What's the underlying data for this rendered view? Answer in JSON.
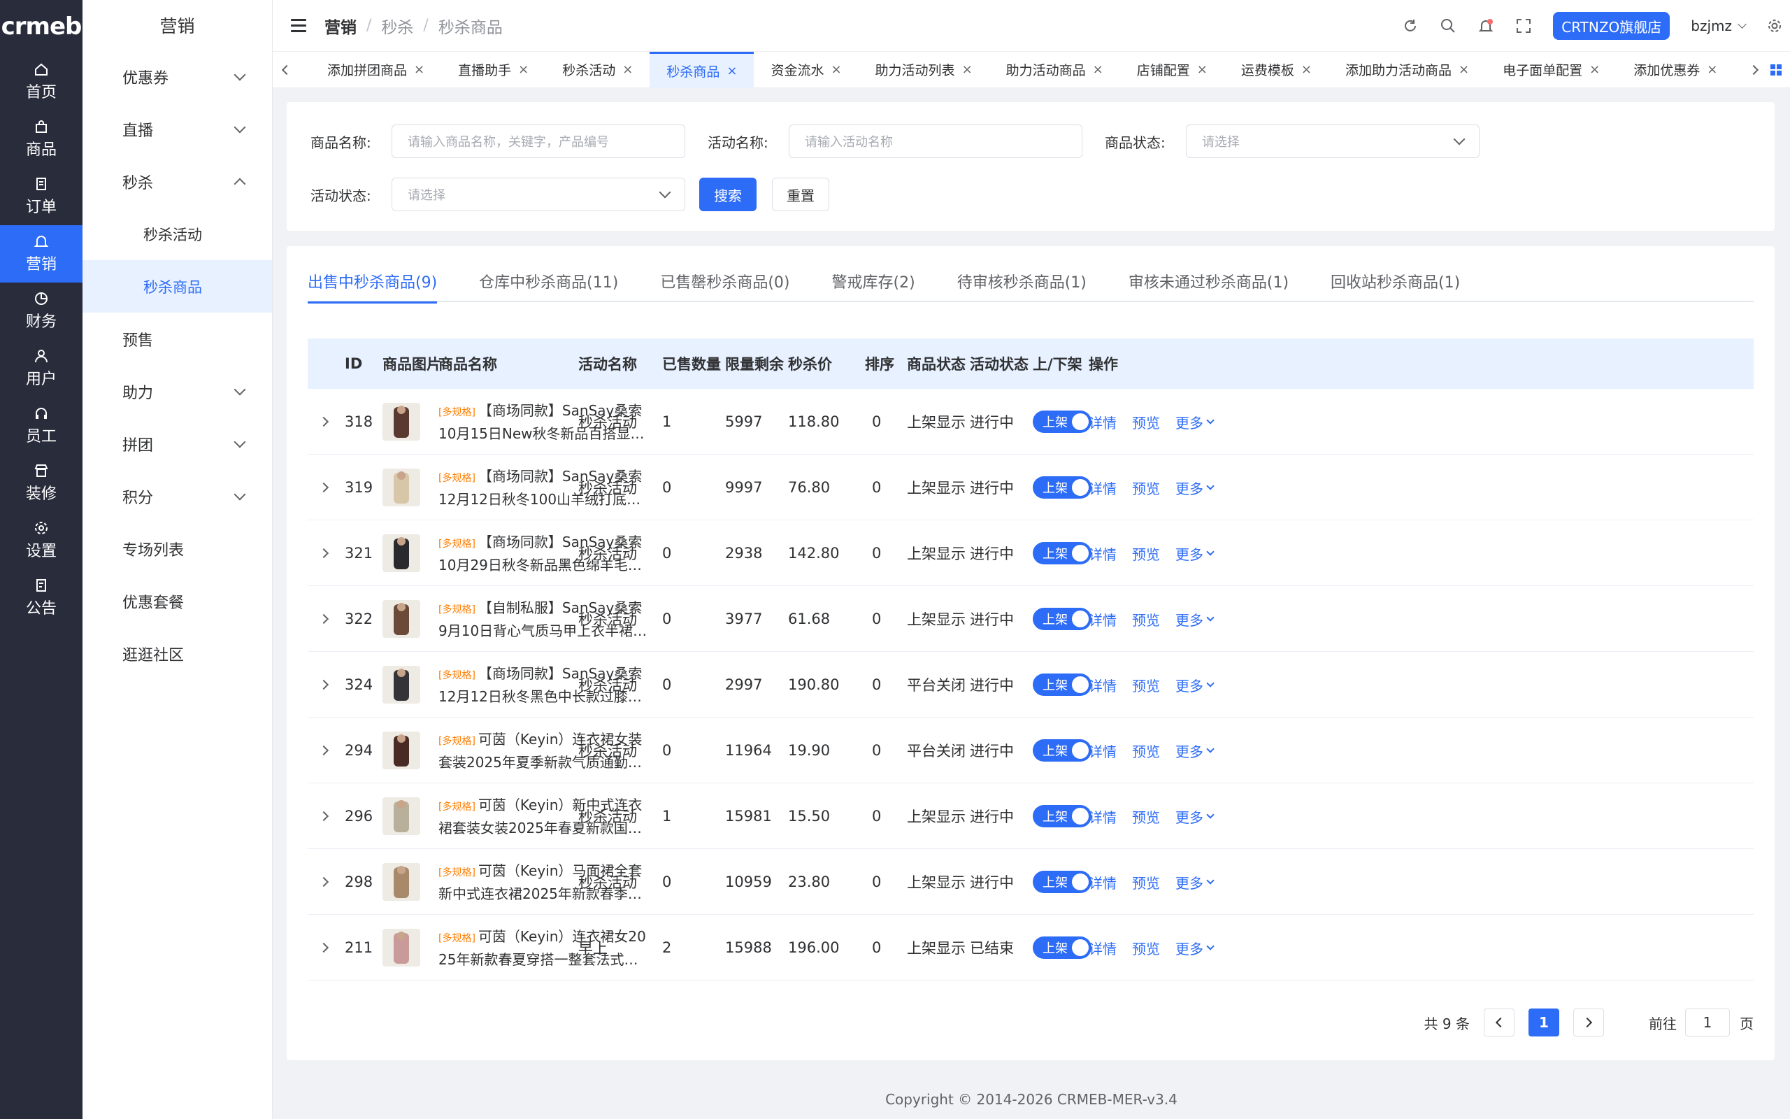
{
  "logo": "crmeb",
  "rail": [
    {
      "label": "首页",
      "icon": "home-icon"
    },
    {
      "label": "商品",
      "icon": "bag-icon"
    },
    {
      "label": "订单",
      "icon": "order-icon"
    },
    {
      "label": "营销",
      "icon": "bell-icon"
    },
    {
      "label": "财务",
      "icon": "pie-icon"
    },
    {
      "label": "用户",
      "icon": "user-icon"
    },
    {
      "label": "员工",
      "icon": "headset-icon"
    },
    {
      "label": "装修",
      "icon": "shop-icon"
    },
    {
      "label": "设置",
      "icon": "gear-icon"
    },
    {
      "label": "公告",
      "icon": "notice-icon"
    }
  ],
  "sub_menu": {
    "title": "营销",
    "items": [
      {
        "label": "优惠券"
      },
      {
        "label": "直播"
      },
      {
        "label": "秒杀"
      },
      {
        "label": "秒杀活动"
      },
      {
        "label": "秒杀商品"
      },
      {
        "label": "预售"
      },
      {
        "label": "助力"
      },
      {
        "label": "拼团"
      },
      {
        "label": "积分"
      },
      {
        "label": "专场列表"
      },
      {
        "label": "优惠套餐"
      },
      {
        "label": "逛逛社区"
      }
    ]
  },
  "breadcrumb": [
    "营销",
    "秒杀",
    "秒杀商品"
  ],
  "breadcrumb_sep": "/",
  "header": {
    "store": "CRTNZO旗舰店",
    "user": "bzjmz"
  },
  "tabs": [
    "添加拼团商品",
    "直播助手",
    "秒杀活动",
    "秒杀商品",
    "资金流水",
    "助力活动列表",
    "助力活动商品",
    "店铺配置",
    "运费模板",
    "添加助力活动商品",
    "电子面单配置",
    "添加优惠券"
  ],
  "tab_close": "×",
  "filter": {
    "product_name_label": "商品名称:",
    "product_name_placeholder": "请输入商品名称，关键字，产品编号",
    "activity_name_label": "活动名称:",
    "activity_name_placeholder": "请输入活动名称",
    "product_status_label": "商品状态:",
    "product_status_placeholder": "请选择",
    "activity_status_label": "活动状态:",
    "activity_status_placeholder": "请选择",
    "search": "搜索",
    "reset": "重置"
  },
  "panel_tabs": [
    "出售中秒杀商品(9)",
    "仓库中秒杀商品(11)",
    "已售罄秒杀商品(0)",
    "警戒库存(2)",
    "待审核秒杀商品(1)",
    "审核未通过秒杀商品(1)",
    "回收站秒杀商品(1)"
  ],
  "columns": [
    "ID",
    "商品图片",
    "商品名称",
    "活动名称",
    "已售数量",
    "限量剩余",
    "秒杀价",
    "排序",
    "商品状态",
    "活动状态",
    "上/下架",
    "操作"
  ],
  "spec_tag": "[多规格]",
  "switch_label": "上架",
  "actions": {
    "detail": "详情",
    "preview": "预览",
    "more": "更多"
  },
  "rows": [
    {
      "id": "318",
      "name1": "【商场同款】SanSay桑索",
      "name2": "10月15日New秋冬新品百搭显瘦…",
      "activity": "秒杀活动",
      "sold": "1",
      "remain": "5997",
      "price": "118.80",
      "sort": "0",
      "pstatus": "上架显示",
      "astatus": "进行中",
      "color": "#5a3a30"
    },
    {
      "id": "319",
      "name1": "【商场同款】SanSay桑索",
      "name2": "12月12日秋冬100山羊绒打底衫…",
      "activity": "秒杀活动",
      "sold": "0",
      "remain": "9997",
      "price": "76.80",
      "sort": "0",
      "pstatus": "上架显示",
      "astatus": "进行中",
      "color": "#d8c6a8"
    },
    {
      "id": "321",
      "name1": "【商场同款】SanSay桑索",
      "name2": "10月29日秋冬新品黑色绵羊毛呢…",
      "activity": "秒杀活动",
      "sold": "0",
      "remain": "2938",
      "price": "142.80",
      "sort": "0",
      "pstatus": "上架显示",
      "astatus": "进行中",
      "color": "#2a2a2e"
    },
    {
      "id": "322",
      "name1": "【自制私服】SanSay桑索",
      "name2": "9月10日背心气质马甲上衣半裙…",
      "activity": "秒杀活动",
      "sold": "0",
      "remain": "3977",
      "price": "61.68",
      "sort": "0",
      "pstatus": "上架显示",
      "astatus": "进行中",
      "color": "#6b4a3a"
    },
    {
      "id": "324",
      "name1": "【商场同款】SanSay桑索",
      "name2": "12月12日秋冬黑色中长款过膝羽…",
      "activity": "秒杀活动",
      "sold": "0",
      "remain": "2997",
      "price": "190.80",
      "sort": "0",
      "pstatus": "平台关闭",
      "astatus": "进行中",
      "color": "#333338"
    },
    {
      "id": "294",
      "name1": "可茵（Keyin）连衣裙女装",
      "name2": "套装2025年夏季新款气质通勤百…",
      "activity": "秒杀活动",
      "sold": "0",
      "remain": "11964",
      "price": "19.90",
      "sort": "0",
      "pstatus": "平台关闭",
      "astatus": "进行中",
      "color": "#4a2a24"
    },
    {
      "id": "296",
      "name1": "可茵（Keyin）新中式连衣",
      "name2": "裙套装女装2025年春夏新款国风…",
      "activity": "秒杀活动",
      "sold": "1",
      "remain": "15981",
      "price": "15.50",
      "sort": "0",
      "pstatus": "上架显示",
      "astatus": "进行中",
      "color": "#b8b09a"
    },
    {
      "id": "298",
      "name1": "可茵（Keyin）马面裙全套",
      "name2": "新中式连衣裙2025年新款春季套…",
      "activity": "秒杀活动",
      "sold": "0",
      "remain": "10959",
      "price": "23.80",
      "sort": "0",
      "pstatus": "上架显示",
      "astatus": "进行中",
      "color": "#a88a6a"
    },
    {
      "id": "211",
      "name1": "可茵（Keyin）连衣裙女20",
      "name2": "25年新款春夏穿搭一整套法式气…",
      "activity": "早上",
      "sold": "2",
      "remain": "15988",
      "price": "196.00",
      "sort": "0",
      "pstatus": "上架显示",
      "astatus": "已结束",
      "color": "#c99a9a"
    }
  ],
  "pager": {
    "total": "共 9 条",
    "current": "1",
    "goto_label": "前往",
    "goto_value": "1",
    "page_suffix": "页"
  },
  "footer": "Copyright © 2014-2026 CRMEB-MER-v3.4",
  "accent": "#2d6cf6"
}
